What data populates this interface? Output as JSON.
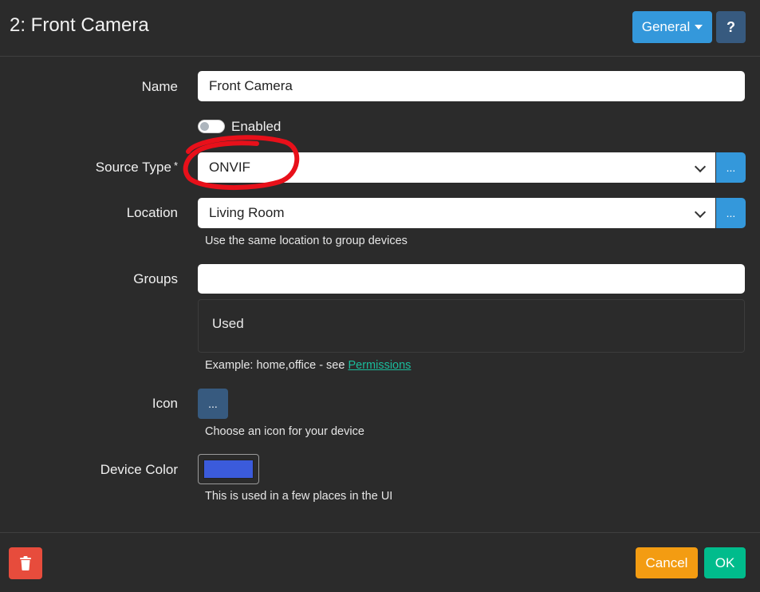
{
  "dialog": {
    "title": "2: Front Camera",
    "tab_dropdown": "General",
    "help_label": "?"
  },
  "form": {
    "name": {
      "label": "Name",
      "value": "Front Camera"
    },
    "enabled": {
      "label": "Enabled",
      "checked": false
    },
    "source_type": {
      "label": "Source Type",
      "required_marker": "*",
      "value": "ONVIF",
      "button": "..."
    },
    "location": {
      "label": "Location",
      "value": "Living Room",
      "button": "...",
      "help": "Use the same location to group devices"
    },
    "groups": {
      "label": "Groups",
      "value": "",
      "used_title": "Used",
      "help_prefix": "Example: home,office - see ",
      "help_link": "Permissions"
    },
    "icon": {
      "label": "Icon",
      "button": "...",
      "help": "Choose an icon for your device"
    },
    "device_color": {
      "label": "Device Color",
      "value": "#3b5bdb",
      "help": "This is used in a few places in the UI"
    }
  },
  "footer": {
    "cancel_label": "Cancel",
    "ok_label": "OK"
  },
  "colors": {
    "annotation": "#e8101a"
  }
}
